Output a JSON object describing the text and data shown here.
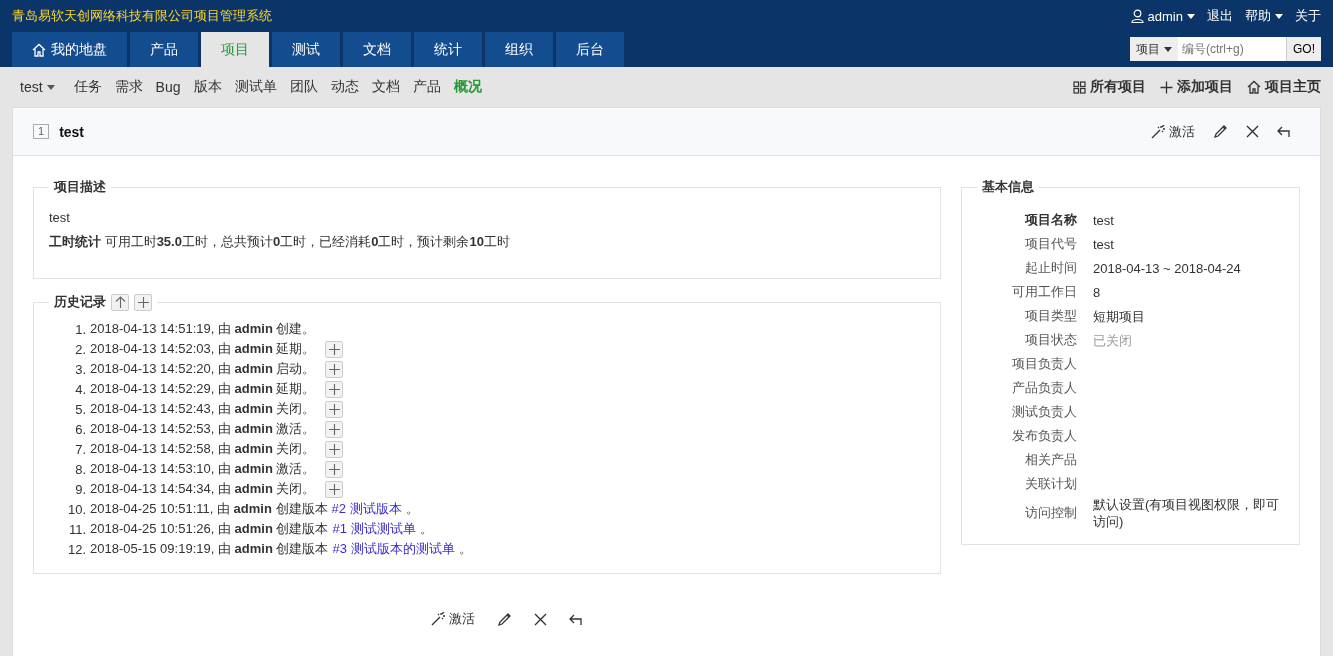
{
  "app_title": "青岛易软天创网络科技有限公司项目管理系统",
  "user_menu": {
    "user": "admin",
    "logout": "退出",
    "help": "帮助",
    "about": "关于"
  },
  "main_tabs": [
    {
      "label": "我的地盘",
      "selected": false
    },
    {
      "label": "产品",
      "selected": false
    },
    {
      "label": "项目",
      "selected": true
    },
    {
      "label": "测试",
      "selected": false
    },
    {
      "label": "文档",
      "selected": false
    },
    {
      "label": "统计",
      "selected": false
    },
    {
      "label": "组织",
      "selected": false
    },
    {
      "label": "后台",
      "selected": false
    }
  ],
  "quick_search": {
    "type": "项目",
    "placeholder": "编号(ctrl+g)",
    "button": "GO!"
  },
  "project_switcher": "test",
  "sub_nav": [
    {
      "label": "任务",
      "selected": false
    },
    {
      "label": "需求",
      "selected": false
    },
    {
      "label": "Bug",
      "selected": false
    },
    {
      "label": "版本",
      "selected": false
    },
    {
      "label": "测试单",
      "selected": false
    },
    {
      "label": "团队",
      "selected": false
    },
    {
      "label": "动态",
      "selected": false
    },
    {
      "label": "文档",
      "selected": false
    },
    {
      "label": "产品",
      "selected": false
    },
    {
      "label": "概况",
      "selected": true
    }
  ],
  "sub_actions": [
    {
      "label": "所有项目"
    },
    {
      "label": "添加项目"
    },
    {
      "label": "项目主页"
    }
  ],
  "header": {
    "id": "1",
    "name": "test",
    "activate": "激活"
  },
  "description": {
    "legend": "项目描述",
    "text": "test",
    "hours": "**工时统计** 可用工时**35.0**工时，总共预计**0**工时，已经消耗**0**工时，预计剩余**10**工时"
  },
  "history": {
    "legend": "历史记录",
    "items": [
      {
        "number": "1.",
        "text": "2018-04-13 14:51:19, 由 **admin** 创建。",
        "expandable": false
      },
      {
        "number": "2.",
        "text": "2018-04-13 14:52:03, 由 **admin** 延期。",
        "expandable": true
      },
      {
        "number": "3.",
        "text": "2018-04-13 14:52:20, 由 **admin** 启动。",
        "expandable": true
      },
      {
        "number": "4.",
        "text": "2018-04-13 14:52:29, 由 **admin** 延期。",
        "expandable": true
      },
      {
        "number": "5.",
        "text": "2018-04-13 14:52:43, 由 **admin** 关闭。",
        "expandable": true
      },
      {
        "number": "6.",
        "text": "2018-04-13 14:52:53, 由 **admin** 激活。",
        "expandable": true
      },
      {
        "number": "7.",
        "text": "2018-04-13 14:52:58, 由 **admin** 关闭。",
        "expandable": true
      },
      {
        "number": "8.",
        "text": "2018-04-13 14:53:10, 由 **admin** 激活。",
        "expandable": true
      },
      {
        "number": "9.",
        "text": "2018-04-13 14:54:34, 由 **admin** 关闭。",
        "expandable": true
      },
      {
        "number": "10.",
        "text": "2018-04-25 10:51:11, 由 **admin** 创建版本",
        "link": "#2 测试版本",
        "tail": "。",
        "expandable": false
      },
      {
        "number": "11.",
        "text": "2018-04-25 10:51:26, 由 **admin** 创建版本",
        "link": "#1 测试测试单",
        "tail": "。",
        "expandable": false
      },
      {
        "number": "12.",
        "text": "2018-05-15 09:19:19, 由 **admin** 创建版本",
        "link": "#3 测试版本的测试单",
        "tail": "。",
        "expandable": false
      }
    ]
  },
  "basic_info": {
    "legend": "基本信息",
    "rows": [
      {
        "label": "项目名称",
        "value": "test",
        "kind": "bold"
      },
      {
        "label": "项目代号",
        "value": "test",
        "kind": "normal"
      },
      {
        "label": "起止时间",
        "value": "2018-04-13 ~ 2018-04-24",
        "kind": "normal"
      },
      {
        "label": "可用工作日",
        "value": "8",
        "kind": "normal"
      },
      {
        "label": "项目类型",
        "value": "短期项目",
        "kind": "normal"
      },
      {
        "label": "项目状态",
        "value": "已关闭",
        "kind": "muted"
      },
      {
        "label": "项目负责人",
        "kind": "normal"
      },
      {
        "label": "产品负责人",
        "kind": "normal"
      },
      {
        "label": "测试负责人",
        "kind": "normal"
      },
      {
        "label": "发布负责人",
        "kind": "normal"
      },
      {
        "label": "相关产品",
        "kind": "normal"
      },
      {
        "label": "关联计划",
        "kind": "normal"
      },
      {
        "label": "访问控制",
        "value": "默认设置(有项目视图权限，即可访问)",
        "kind": "normal"
      }
    ]
  },
  "footer_actions": {
    "activate": "激活"
  }
}
